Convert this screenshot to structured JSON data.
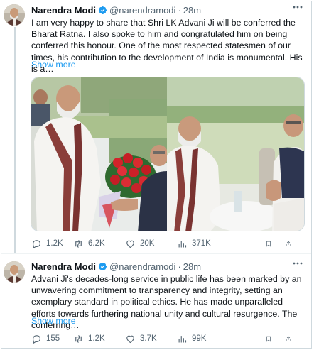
{
  "colors": {
    "accent": "#1d9bf0",
    "text_primary": "#0f1419",
    "text_secondary": "#536471",
    "border": "#cfd9de"
  },
  "tweets": [
    {
      "author_name": "Narendra Modi",
      "handle": "@narendramodi",
      "separator": "·",
      "time": "28m",
      "verified_icon": "verified-badge-icon",
      "text": "I am very happy to share that Shri LK Advani Ji will be conferred the Bharat Ratna. I also spoke to him and congratulated him on being conferred this honour. One of the most respected statesmen of our times, his contribution to the development of India is monumental. His is a…",
      "show_more": "Show more",
      "has_media": true,
      "stats": {
        "replies": "1.2K",
        "reposts": "6.2K",
        "likes": "20K",
        "views": "371K"
      }
    },
    {
      "author_name": "Narendra Modi",
      "handle": "@narendramodi",
      "separator": "·",
      "time": "28m",
      "verified_icon": "verified-badge-icon",
      "text": "Advani Ji's decades-long service in public life has been marked by an unwavering commitment to transparency and integrity, setting an exemplary standard in political ethics. He has made unparalleled efforts towards furthering national unity and cultural resurgence. The conferring…",
      "show_more": "Show more",
      "has_media": false,
      "stats": {
        "replies": "155",
        "reposts": "1.2K",
        "likes": "3.7K",
        "views": "99K"
      }
    }
  ]
}
